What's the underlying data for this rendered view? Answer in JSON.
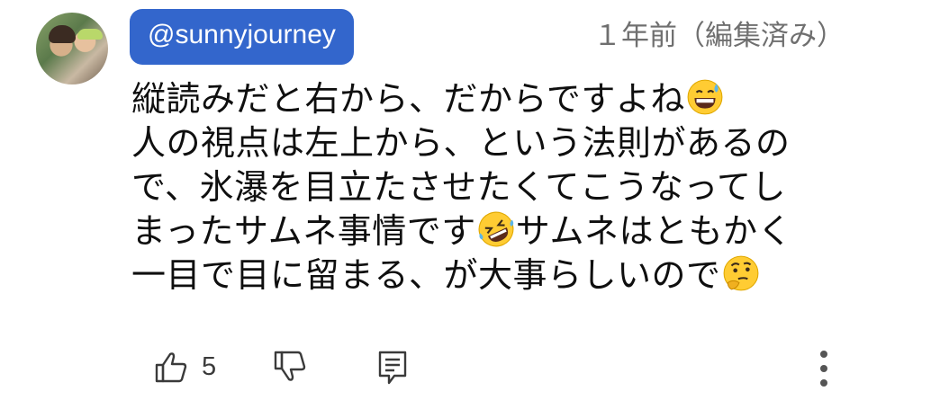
{
  "author": {
    "handle": "@sunnyjourney"
  },
  "timestamp": "１年前（編集済み）",
  "comment": {
    "lines": [
      "縦読みだと右から、だからですよね",
      "人の視点は左上から、という法則があるの",
      "で、氷瀑を目立たさせたくてこうなってし",
      "まったサムネ事情です",
      "一目で目に留まる、が大事らしいので"
    ],
    "line4_tail": "サムネはともかく"
  },
  "emojis": {
    "line1": "grinning-face-with-sweat",
    "line4": "rolling-on-the-floor-laughing",
    "line5": "thinking-face"
  },
  "actions": {
    "like_count": "5"
  },
  "colors": {
    "chip_bg": "#3366cc",
    "timestamp": "#6f6f6f",
    "text": "#0f0f0f"
  }
}
